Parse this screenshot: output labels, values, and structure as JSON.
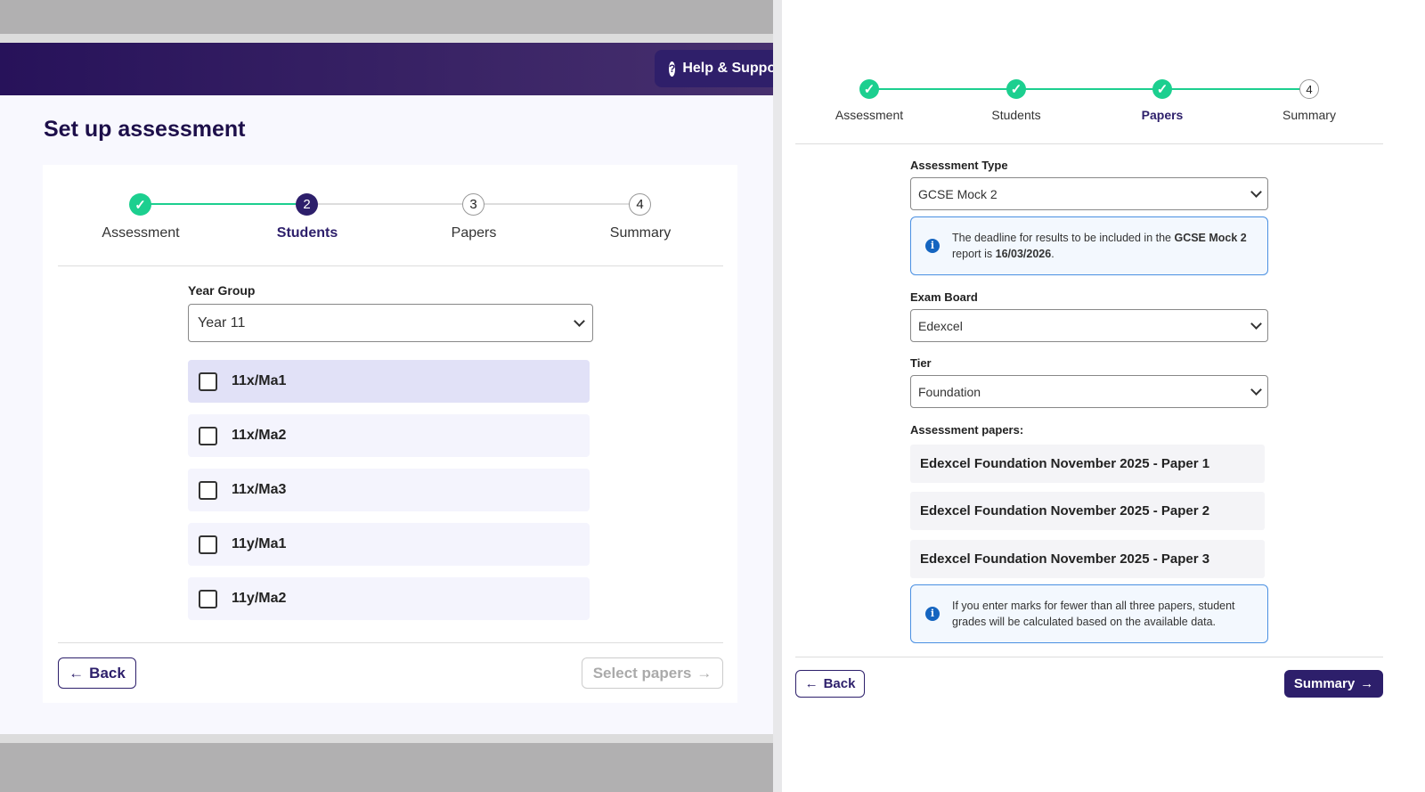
{
  "header": {
    "help_label": "Help & Support"
  },
  "left": {
    "title": "Set up assessment",
    "steps": [
      {
        "n": "1",
        "label": "Assessment",
        "state": "done"
      },
      {
        "n": "2",
        "label": "Students",
        "state": "active"
      },
      {
        "n": "3",
        "label": "Papers",
        "state": "todo"
      },
      {
        "n": "4",
        "label": "Summary",
        "state": "todo"
      }
    ],
    "year_group_label": "Year Group",
    "year_group_value": "Year 11",
    "classes": [
      "11x/Ma1",
      "11x/Ma2",
      "11x/Ma3",
      "11y/Ma1",
      "11y/Ma2"
    ],
    "back_label": "Back",
    "next_label": "Select papers"
  },
  "right": {
    "steps": [
      {
        "label": "Assessment",
        "state": "done"
      },
      {
        "label": "Students",
        "state": "done"
      },
      {
        "label": "Papers",
        "state": "active"
      },
      {
        "n": "4",
        "label": "Summary",
        "state": "todo"
      }
    ],
    "assessment_type_label": "Assessment Type",
    "assessment_type_value": "GCSE Mock 2",
    "deadline_info": {
      "pre": "The deadline for results to be included in the ",
      "bold1": "GCSE Mock 2",
      "mid": " report is ",
      "bold2": "16/03/2026",
      "post": "."
    },
    "exam_board_label": "Exam Board",
    "exam_board_value": "Edexcel",
    "tier_label": "Tier",
    "tier_value": "Foundation",
    "papers_label": "Assessment papers:",
    "papers": [
      "Edexcel Foundation November 2025 - Paper 1",
      "Edexcel Foundation November 2025 - Paper 2",
      "Edexcel Foundation November 2025 - Paper 3"
    ],
    "fewer_info": "If you enter marks for fewer than all three papers, student grades will be calculated based on the available data.",
    "back_label": "Back",
    "next_label": "Summary"
  }
}
